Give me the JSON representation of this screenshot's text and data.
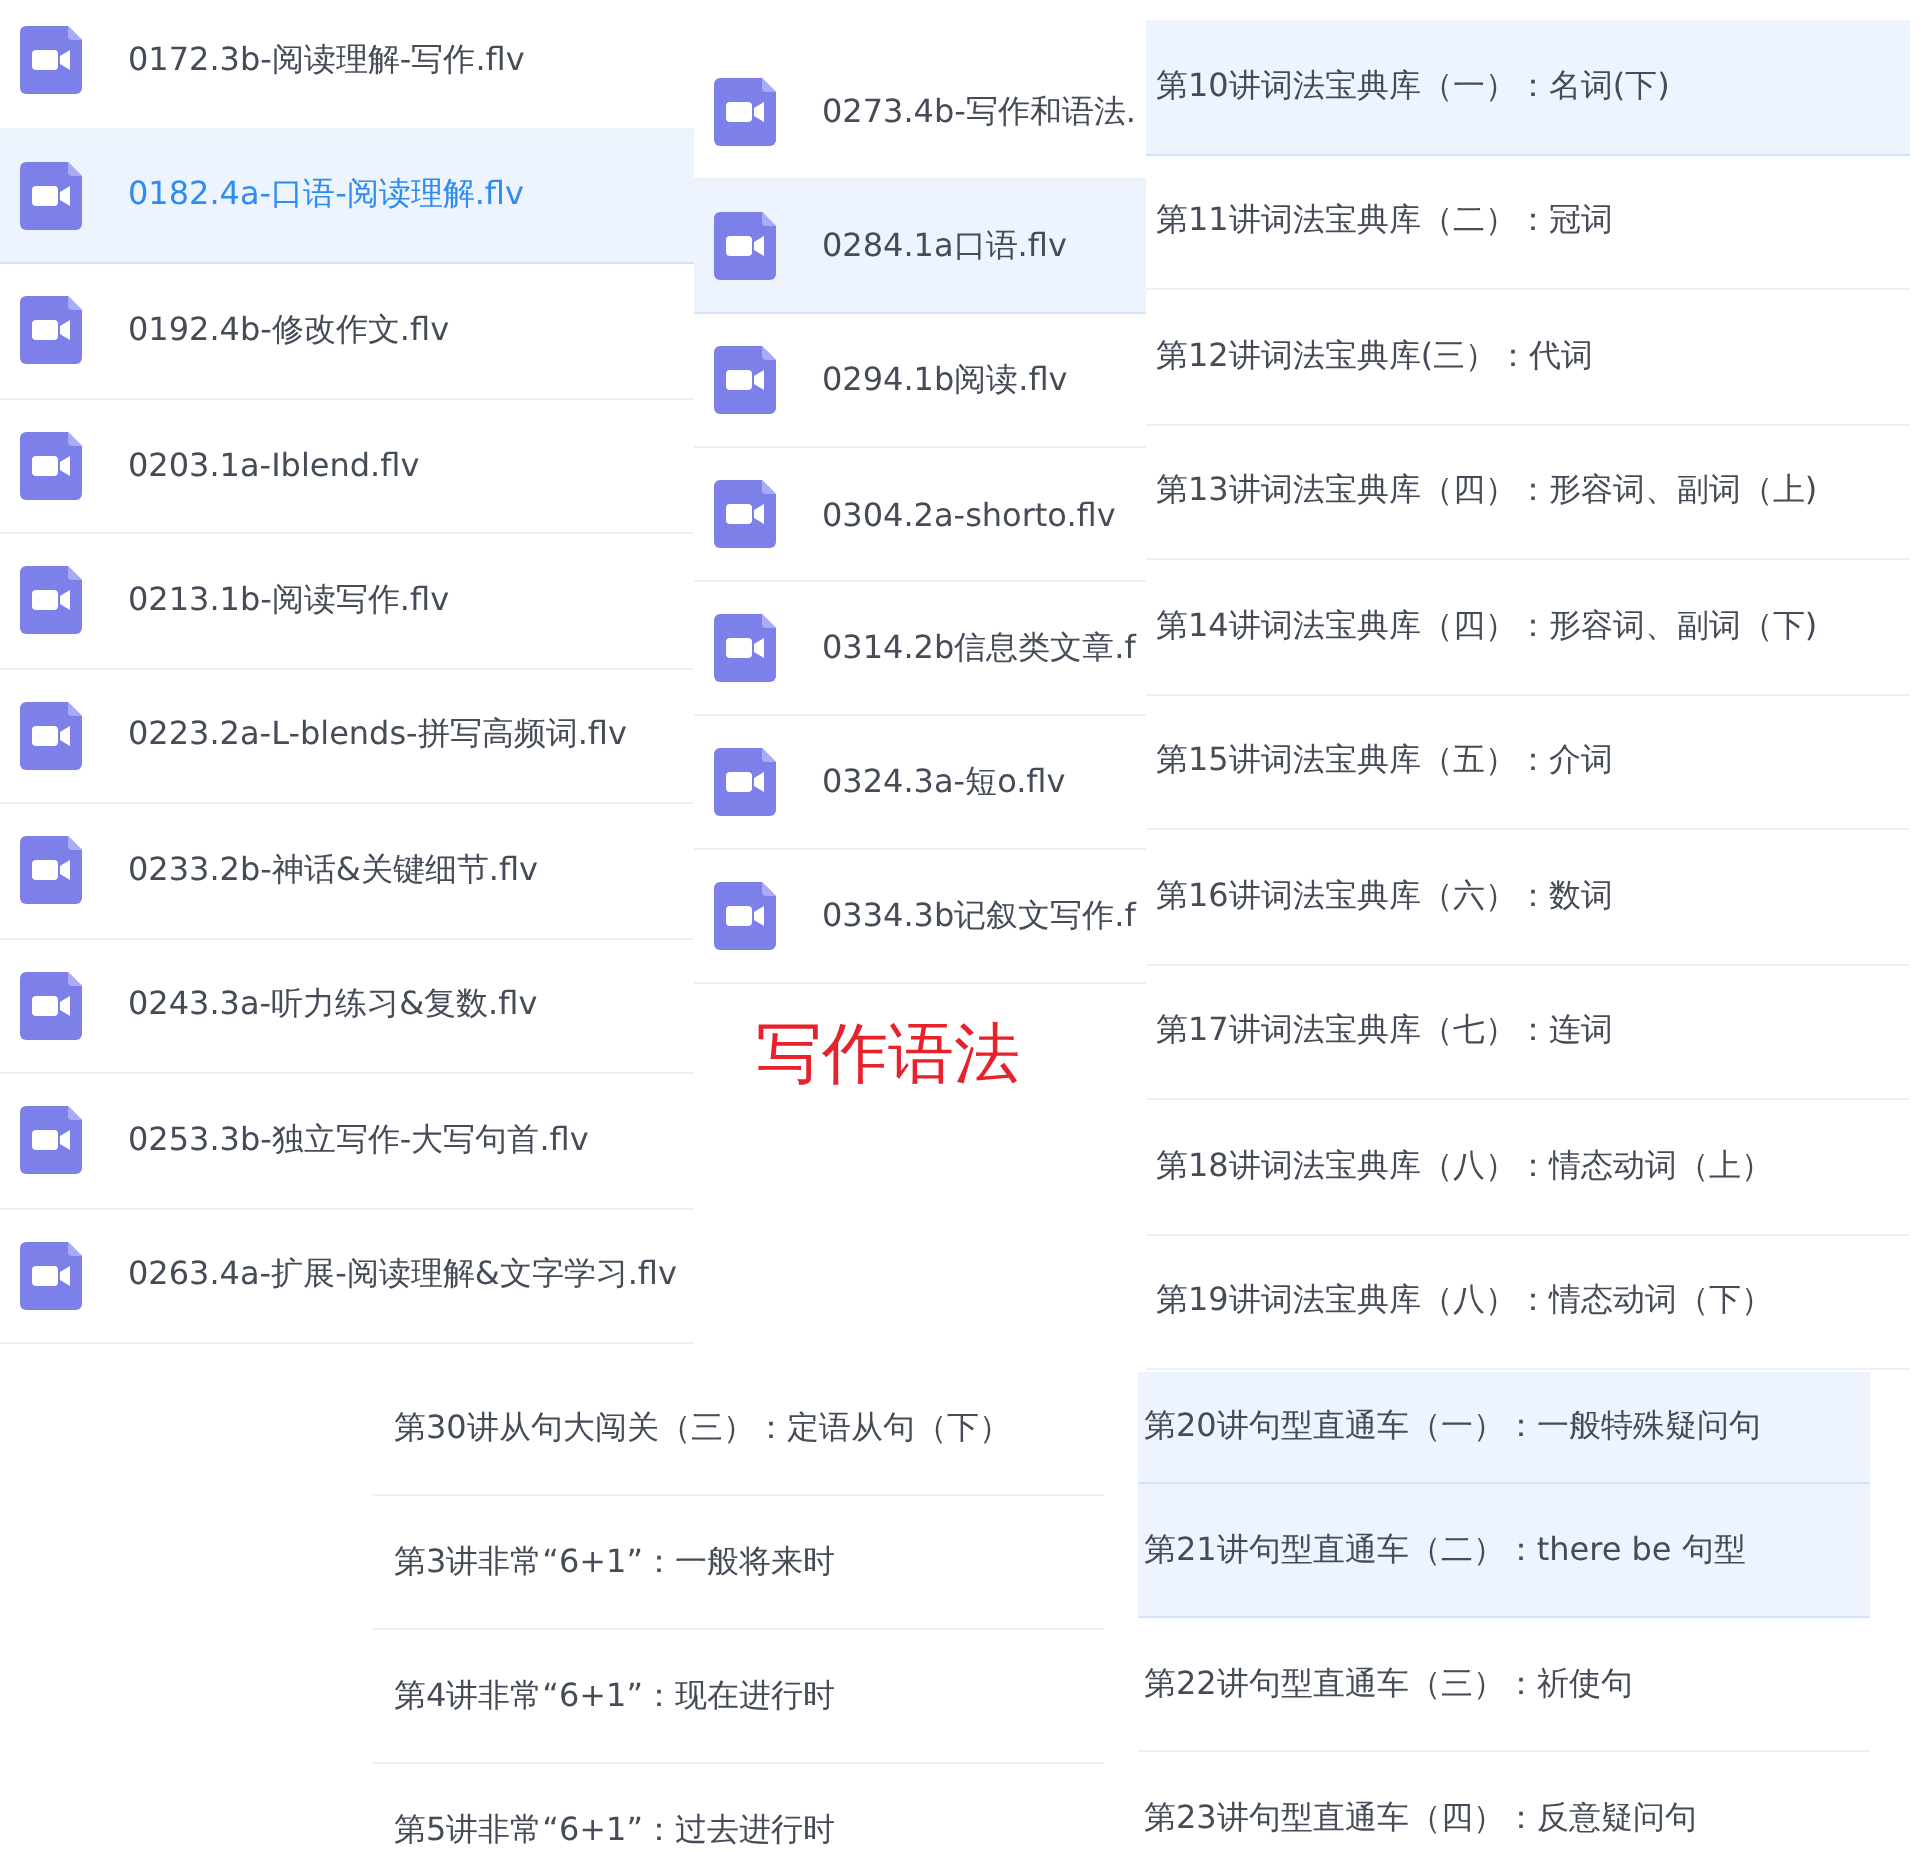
{
  "panels": [
    {
      "kind": "file_list",
      "items": [
        {
          "name": "0172.3b-阅读理解-写作.flv",
          "selected": false
        },
        {
          "name": "0182.4a-口语-阅读理解.flv",
          "selected": true
        },
        {
          "name": "0192.4b-修改作文.flv",
          "selected": false
        },
        {
          "name": "0203.1a-Iblend.flv",
          "selected": false
        },
        {
          "name": "0213.1b-阅读写作.flv",
          "selected": false
        },
        {
          "name": "0223.2a-L-blends-拼写高频词.flv",
          "selected": false
        },
        {
          "name": "0233.2b-神话&关键细节.flv",
          "selected": false
        },
        {
          "name": "0243.3a-听力练习&复数.flv",
          "selected": false
        },
        {
          "name": "0253.3b-独立写作-大写句首.flv",
          "selected": false
        },
        {
          "name": "0263.4a-扩展-阅读理解&文字学习.flv",
          "selected": false
        }
      ]
    },
    {
      "kind": "file_list",
      "items": [
        {
          "name": "0273.4b-写作和语法.",
          "selected": false
        },
        {
          "name": "0284.1a口语.flv",
          "selected": true
        },
        {
          "name": "0294.1b阅读.flv",
          "selected": false
        },
        {
          "name": "0304.2a-shorto.flv",
          "selected": false
        },
        {
          "name": "0314.2b信息类文章.f",
          "selected": false
        },
        {
          "name": "0324.3a-短o.flv",
          "selected": false
        },
        {
          "name": "0334.3b记叙文写作.f",
          "selected": false
        }
      ]
    },
    {
      "kind": "text_list",
      "items": [
        {
          "name": "第10讲词法宝典库（一）：名词(下)",
          "selected": true
        },
        {
          "name": "第11讲词法宝典库（二）：冠词",
          "selected": false
        },
        {
          "name": "第12讲词法宝典库(三）：代词",
          "selected": false
        },
        {
          "name": "第13讲词法宝典库（四）：形容词、副词（上)",
          "selected": false
        },
        {
          "name": "第14讲词法宝典库（四）：形容词、副词（下)",
          "selected": false
        },
        {
          "name": "第15讲词法宝典库（五）：介词",
          "selected": false
        },
        {
          "name": "第16讲词法宝典库（六）：数词",
          "selected": false
        },
        {
          "name": "第17讲词法宝典库（七）：连词",
          "selected": false
        },
        {
          "name": "第18讲词法宝典库（八）：情态动词（上）",
          "selected": false
        },
        {
          "name": "第19讲词法宝典库（八）：情态动词（下）",
          "selected": false
        }
      ]
    },
    {
      "kind": "title",
      "text": "写作语法"
    },
    {
      "kind": "text_list",
      "items": [
        {
          "name": "第30讲从句大闯关（三）：定语从句（下）",
          "selected": false
        },
        {
          "name": "第3讲非常“6+1”：一般将来时",
          "selected": false
        },
        {
          "name": "第4讲非常“6+1”：现在进行时",
          "selected": false
        },
        {
          "name": "第5讲非常“6+1”：过去进行时",
          "selected": false
        }
      ]
    },
    {
      "kind": "text_list",
      "items": [
        {
          "name": "第20讲句型直通车（一）：一般特殊疑问句",
          "selected": true
        },
        {
          "name": "第21讲句型直通车（二）：there be 句型",
          "selected": true
        },
        {
          "name": "第22讲句型直通车（三）：祈使句",
          "selected": false
        },
        {
          "name": "第23讲句型直通车（四）：反意疑问句",
          "selected": false
        }
      ]
    }
  ]
}
